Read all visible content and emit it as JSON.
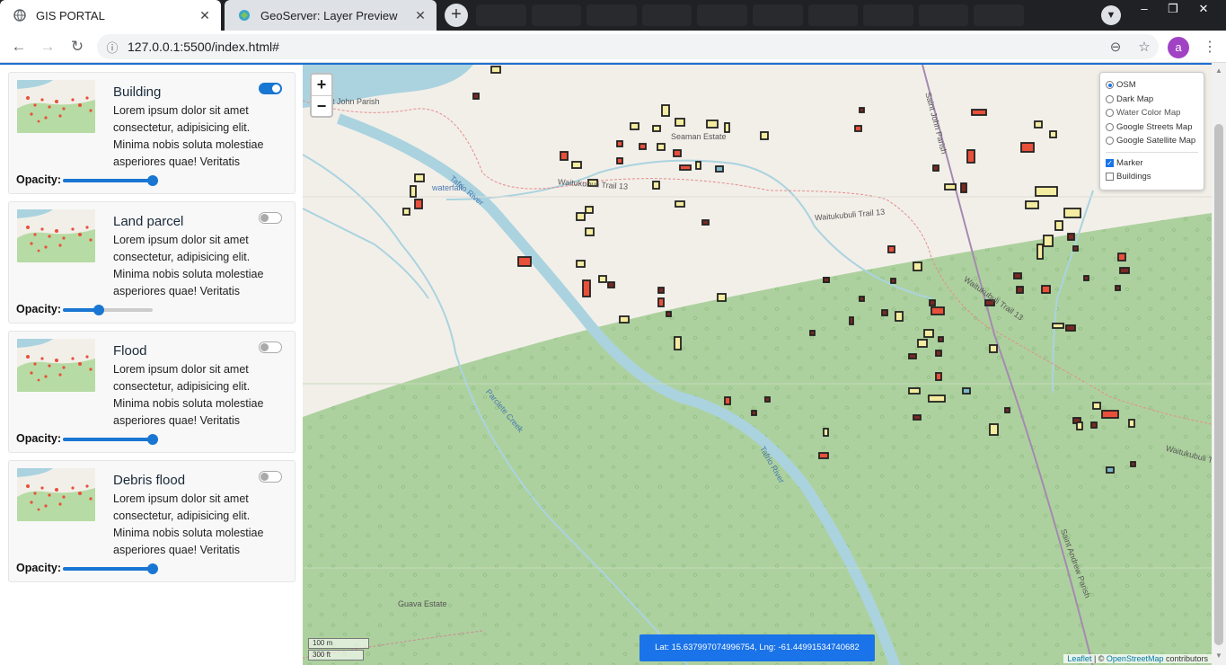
{
  "browser": {
    "tabs": [
      {
        "title": "GIS PORTAL",
        "active": true
      },
      {
        "title": "GeoServer: Layer Preview",
        "active": false
      }
    ],
    "url": "127.0.0.1:5500/index.html#",
    "profile_initial": "a",
    "window_controls": [
      "–",
      "❐",
      "✕"
    ]
  },
  "sidebar": {
    "opacity_label": "Opacity:",
    "layers": [
      {
        "title": "Building",
        "description": "Lorem ipsum dolor sit amet consectetur, adipisicing elit. Minima nobis soluta molestiae asperiores quae! Veritatis",
        "enabled": true,
        "opacity": 1.0
      },
      {
        "title": "Land parcel",
        "description": "Lorem ipsum dolor sit amet consectetur, adipisicing elit. Minima nobis soluta molestiae asperiores quae! Veritatis",
        "enabled": false,
        "opacity": 0.4
      },
      {
        "title": "Flood",
        "description": "Lorem ipsum dolor sit amet consectetur, adipisicing elit. Minima nobis soluta molestiae asperiores quae! Veritatis",
        "enabled": false,
        "opacity": 1.0
      },
      {
        "title": "Debris flood",
        "description": "Lorem ipsum dolor sit amet consectetur, adipisicing elit. Minima nobis soluta molestiae asperiores quae! Veritatis",
        "enabled": false,
        "opacity": 1.0
      }
    ]
  },
  "map": {
    "zoom_in": "+",
    "zoom_out": "−",
    "basemaps": [
      {
        "label": "OSM",
        "selected": true
      },
      {
        "label": "Dark Map",
        "selected": false
      },
      {
        "label": "Water Color Map",
        "selected": false
      },
      {
        "label": "Google Streets Map",
        "selected": false
      },
      {
        "label": "Google Satellite Map",
        "selected": false
      }
    ],
    "overlays": [
      {
        "label": "Marker",
        "checked": true
      },
      {
        "label": "Buildings",
        "checked": false
      }
    ],
    "labels": {
      "estate1": "Seaman Estate",
      "estate2": "Guava Estate",
      "trail1": "Waitukubuli Trail 13",
      "trail2": "Waitukubuli Trail 13",
      "trail3": "Waitukubuli Trail 13",
      "trail4": "Waitukubuli Trail",
      "river": "Tafrio River",
      "river2": "Tafrio River",
      "waterfall": "waterfall",
      "parish1": "Saint John Parish",
      "parish2": "Saint Andrew Parish",
      "parish3": "nt John Parish",
      "track": "Parclete Creek"
    },
    "scale": {
      "metric": "100 m",
      "imperial": "300 ft"
    },
    "coords": "Lat: 15.637997074996754, Lng: -61.44991534740682",
    "attribution": {
      "leaflet": "Leaflet",
      "sep": " | © ",
      "osm": "OpenStreetMap",
      "suffix": " contributors"
    },
    "colors": {
      "land": "#f2efe9",
      "forest": "#add19e",
      "water": "#aad3df",
      "building_yellow": "#f4eca0",
      "building_red": "#e8503a",
      "building_dark": "#7a2a22"
    }
  }
}
